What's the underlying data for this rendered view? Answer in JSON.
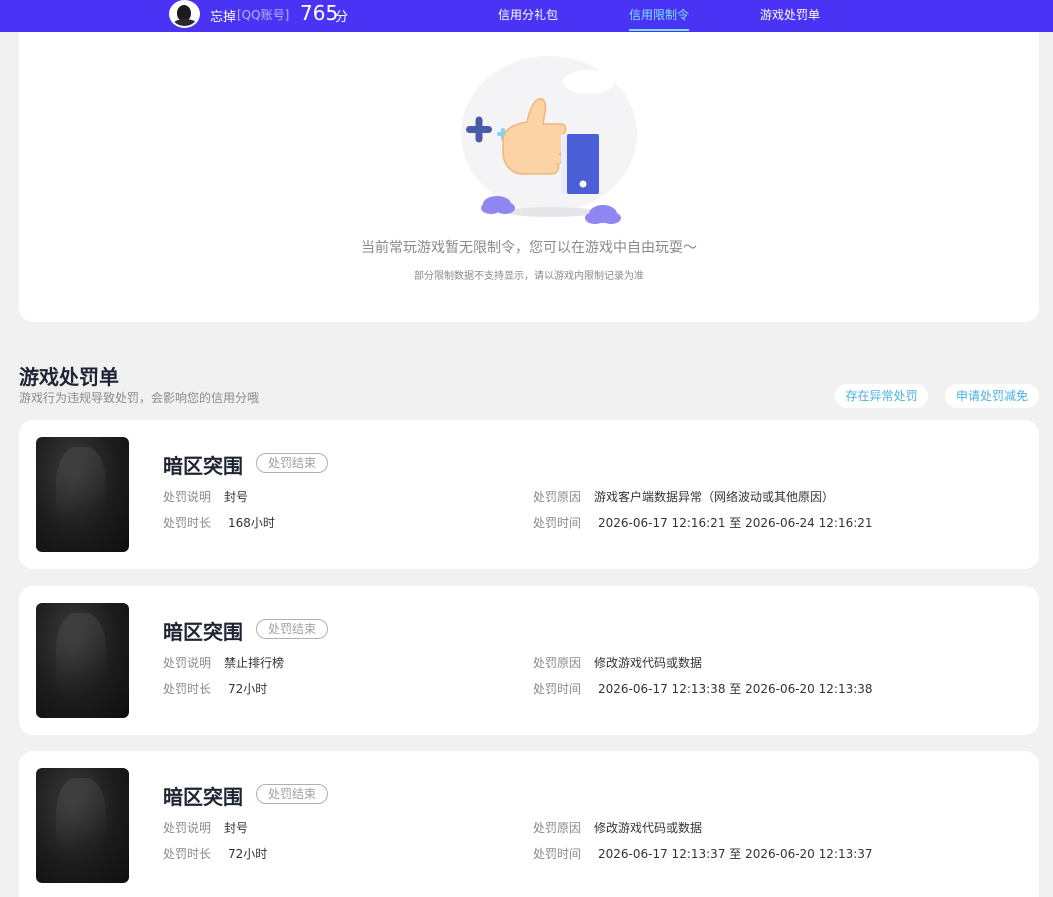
{
  "header": {
    "user_name": "忘掉",
    "account_type": "[QQ账号]",
    "score": "765",
    "score_unit": "分",
    "tabs": [
      {
        "label": "信用分礼包",
        "active": false
      },
      {
        "label": "信用限制令",
        "active": true
      },
      {
        "label": "游戏处罚单",
        "active": false
      }
    ]
  },
  "restriction": {
    "empty_title": "当前常玩游戏暂无限制令，您可以在游戏中自由玩耍～",
    "empty_subtitle": "部分限制数据不支持显示，请以游戏内限制记录为准"
  },
  "penalties": {
    "title": "游戏处罚单",
    "subtitle": "游戏行为违规导致处罚，会影响您的信用分哦",
    "btn_abnormal": "存在异常处罚",
    "btn_appeal": "申请处罚减免",
    "label_desc": "处罚说明",
    "label_duration": "处罚时长",
    "label_reason": "处罚原因",
    "label_time": "处罚时间",
    "records": [
      {
        "game": "暗区突围",
        "status": "处罚结束",
        "desc": "封号",
        "duration": "168小时",
        "reason": "游戏客户端数据异常（网络波动或其他原因）",
        "time": "2026-06-17 12:16:21 至 2026-06-24 12:16:21"
      },
      {
        "game": "暗区突围",
        "status": "处罚结束",
        "desc": "禁止排行榜",
        "duration": "72小时",
        "reason": "修改游戏代码或数据",
        "time": "2026-06-17 12:13:38 至 2026-06-20 12:13:38"
      },
      {
        "game": "暗区突围",
        "status": "处罚结束",
        "desc": "封号",
        "duration": "72小时",
        "reason": "修改游戏代码或数据",
        "time": "2026-06-17 12:13:37 至 2026-06-20 12:13:37"
      }
    ]
  },
  "colors": {
    "header_bg": "#4b33f5",
    "active_tab": "#7be3ff",
    "link": "#4ab1e6"
  },
  "icons": [
    "thumbs-up-illustration-icon",
    "sparkle-plus-icon",
    "cloud-icon"
  ]
}
